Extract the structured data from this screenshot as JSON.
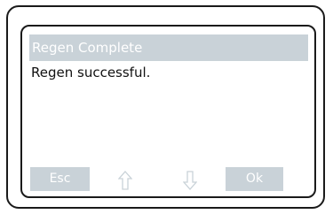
{
  "dialog": {
    "title": "Regen Complete",
    "message": "Regen successful."
  },
  "buttons": {
    "esc_label": "Esc",
    "ok_label": "Ok"
  },
  "icons": {
    "up": "arrow-up-icon",
    "down": "arrow-down-icon"
  },
  "colors": {
    "bar": "#c9d2d8",
    "border": "#1a1a1a",
    "text": "#111111"
  }
}
